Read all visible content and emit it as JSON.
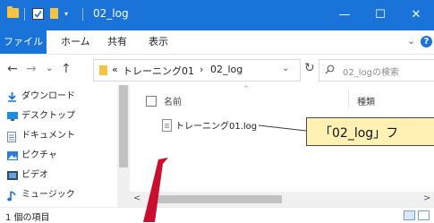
{
  "window": {
    "title": "02_log",
    "minimize_glyph": "—",
    "maximize_glyph": "☐",
    "close_glyph": "✕",
    "accent_color": "#1a73d9"
  },
  "ribbon": {
    "tabs": [
      {
        "label": "ファイル"
      },
      {
        "label": "ホーム"
      },
      {
        "label": "共有"
      },
      {
        "label": "表示"
      }
    ],
    "expand_glyph": "⌄",
    "help_glyph": "?"
  },
  "address_bar": {
    "back_glyph": "←",
    "forward_glyph": "→",
    "recent_glyph": "⌄",
    "up_glyph": "↑",
    "overflow": "«",
    "path": [
      "トレーニング01",
      "02_log"
    ],
    "path_separator": "›",
    "dropdown_glyph": "⌄",
    "refresh_glyph": "↻",
    "search_placeholder": "02_logの検索"
  },
  "sidebar": {
    "items": [
      {
        "label": "ダウンロード",
        "icon": "download-icon"
      },
      {
        "label": "デスクトップ",
        "icon": "desktop-icon"
      },
      {
        "label": "ドキュメント",
        "icon": "documents-icon"
      },
      {
        "label": "ピクチャ",
        "icon": "pictures-icon"
      },
      {
        "label": "ビデオ",
        "icon": "videos-icon"
      },
      {
        "label": "ミュージック",
        "icon": "music-icon"
      }
    ]
  },
  "file_list": {
    "columns": {
      "name": "名前",
      "type": "種類",
      "sort_glyph": "⌃"
    },
    "files": [
      {
        "name": "トレーニング01.log"
      }
    ]
  },
  "scrollbar": {
    "left_glyph": "<",
    "right_glyph": ">"
  },
  "status_bar": {
    "item_count": "1 個の項目"
  },
  "annotation": {
    "callout_text": "「02_log」フ",
    "arrow_color": "#c8102e",
    "callout_bg": "#fff1b3"
  }
}
